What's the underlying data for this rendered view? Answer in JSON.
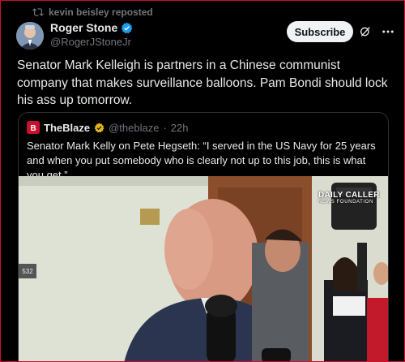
{
  "repost": {
    "text": "kevin beisley reposted",
    "icon": "repost-icon"
  },
  "author": {
    "name": "Roger Stone",
    "handle": "@RogerJStoneJr",
    "verified": true
  },
  "actions": {
    "subscribe_label": "Subscribe",
    "grok_icon": "grok-icon",
    "more_icon": "more-icon"
  },
  "tweet": {
    "text": "Senator Mark Kelleigh is partners in a Chinese communist company that makes surveillance balloons. Pam Bondi should lock his ass up tomorrow."
  },
  "quote": {
    "name": "TheBlaze",
    "handle": "@theblaze",
    "separator": "·",
    "time": "22h",
    "logo_letter": "B",
    "text": "Senator Mark Kelly on Pete Hegseth: “I served in the US Navy for 25 years and when you put somebody who is clearly not up to this job, this is what you get.”",
    "watermark_line1": "DAILY CALLER",
    "watermark_line2": "NEWS FOUNDATION",
    "room_number": "532"
  },
  "colors": {
    "accent_verified": "#1d9bf0",
    "blaze_red": "#c8102e",
    "frame_border": "#c8102e"
  }
}
